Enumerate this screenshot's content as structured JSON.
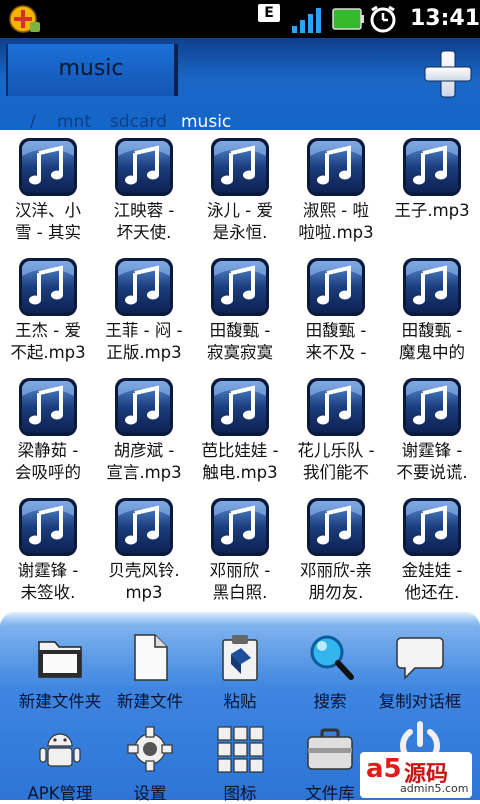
{
  "status_bar": {
    "network_badge": "E",
    "time": "13:41",
    "icons": [
      "app-launcher-icon",
      "signal-icon",
      "battery-icon",
      "alarm-clock-icon"
    ]
  },
  "header": {
    "tab_label": "music",
    "add_icon": "plus-icon",
    "path": [
      "/",
      "mnt",
      "sdcard",
      "music"
    ]
  },
  "files": [
    {
      "line1": "汉洋、小",
      "line2": "雪 - 其实"
    },
    {
      "line1": "江映蓉 -",
      "line2": "坏天使."
    },
    {
      "line1": "泳儿 - 爱",
      "line2": "是永恒."
    },
    {
      "line1": "淑熙 - 啦",
      "line2": "啦啦.mp3"
    },
    {
      "line1": "王子.mp3",
      "line2": ""
    },
    {
      "line1": "王杰 - 爱",
      "line2": "不起.mp3"
    },
    {
      "line1": "王菲 - 闷 -",
      "line2": "正版.mp3"
    },
    {
      "line1": "田馥甄 -",
      "line2": "寂寞寂寞"
    },
    {
      "line1": "田馥甄 -",
      "line2": "来不及 -"
    },
    {
      "line1": "田馥甄 -",
      "line2": "魔鬼中的"
    },
    {
      "line1": "梁静茹 -",
      "line2": "会吸呼的"
    },
    {
      "line1": "胡彦斌 -",
      "line2": "宣言.mp3"
    },
    {
      "line1": "芭比娃娃 -",
      "line2": "触电.mp3"
    },
    {
      "line1": "花儿乐队 -",
      "line2": "我们能不"
    },
    {
      "line1": "谢霆锋 -",
      "line2": "不要说谎."
    },
    {
      "line1": "谢霆锋 -",
      "line2": "未签收."
    },
    {
      "line1": "贝壳风铃.",
      "line2": "mp3"
    },
    {
      "line1": "邓丽欣 -",
      "line2": "黑白照."
    },
    {
      "line1": "邓丽欣-亲",
      "line2": "朋勿友."
    },
    {
      "line1": "金娃娃 -",
      "line2": "他还在."
    }
  ],
  "toolbar": {
    "row1": [
      {
        "label": "新建文件夹",
        "icon": "new-folder-icon"
      },
      {
        "label": "新建文件",
        "icon": "new-file-icon"
      },
      {
        "label": "粘贴",
        "icon": "paste-icon"
      },
      {
        "label": "搜索",
        "icon": "search-icon"
      },
      {
        "label": "复制对话框",
        "icon": "copy-dialog-icon"
      }
    ],
    "row2": [
      {
        "label": "APK管理",
        "icon": "android-icon"
      },
      {
        "label": "设置",
        "icon": "gear-icon"
      },
      {
        "label": "图标",
        "icon": "grid-icon"
      },
      {
        "label": "文件库",
        "icon": "briefcase-icon"
      },
      {
        "label": "",
        "icon": "power-icon"
      }
    ]
  },
  "watermark": {
    "logo": "a5",
    "text": "源码",
    "url": "admin5.com"
  },
  "colors": {
    "header_blue": "#1565c8",
    "toolbar_blue": "#3e86e0",
    "path_active": "#ffffff"
  }
}
